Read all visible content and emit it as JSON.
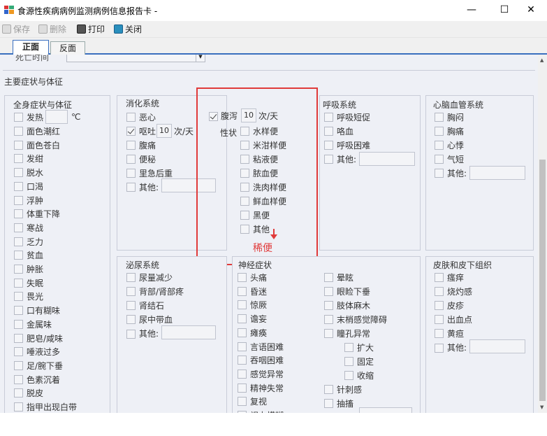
{
  "window": {
    "title": "食源性疾病病例监测病例信息报告卡 -",
    "minimize": "—",
    "maximize": "☐",
    "close": "✕"
  },
  "toolbar": {
    "save": "保存",
    "delete": "删除",
    "print": "打印",
    "close": "关闭"
  },
  "tabs": {
    "front": "正面",
    "back": "反面"
  },
  "partial_label": "死亡时间",
  "section_title": "主要症状与体征",
  "general": {
    "title": "全身症状与体征",
    "fever": "发热",
    "fever_unit": "℃",
    "items": [
      "面色潮红",
      "面色苍白",
      "发绀",
      "脱水",
      "口渴",
      "浮肿",
      "体重下降",
      "寒战",
      "乏力",
      "贫血",
      "肿胀",
      "失眠",
      "畏光",
      "口有糊味",
      "金属味",
      "肥皂/咸味",
      "唾液过多",
      "足/腕下垂",
      "色素沉着",
      "脱皮",
      "指甲出现白带"
    ]
  },
  "digestive": {
    "title": "消化系统",
    "nausea": "恶心",
    "vomit": "呕吐",
    "vomit_count": "10",
    "vomit_unit": "次/天",
    "items": [
      "腹痛",
      "便秘",
      "里急后重"
    ],
    "other": "其他:"
  },
  "diarrhea": {
    "label": "腹泻",
    "count": "10",
    "unit": "次/天",
    "shape_label": "性状",
    "items": [
      "水样便",
      "米泔样便",
      "粘液便",
      "脓血便",
      "洗肉样便",
      "鲜血样便",
      "黑便",
      "其他"
    ],
    "annotation": "稀便"
  },
  "respiratory": {
    "title": "呼吸系统",
    "items": [
      "呼吸短促",
      "咯血",
      "呼吸困难"
    ],
    "other": "其他:"
  },
  "cardio": {
    "title": "心脑血管系统",
    "items": [
      "胸闷",
      "胸痛",
      "心悸",
      "气短"
    ],
    "other": "其他:"
  },
  "urinary": {
    "title": "泌尿系统",
    "items": [
      "尿量减少",
      "背部/肾部疼",
      "肾结石",
      "尿中带血"
    ],
    "other": "其他:"
  },
  "neuro": {
    "title": "神经症状",
    "left": [
      "头痛",
      "昏迷",
      "惊厥",
      "谵妄",
      "瘫痪",
      "言语困难",
      "吞咽困难",
      "感觉异常",
      "精神失常",
      "复视",
      "视力模糊"
    ],
    "right": [
      "晕眩",
      "眼睑下垂",
      "肢体麻木",
      "末梢感觉障碍",
      "瞳孔异常"
    ],
    "pupil": [
      "扩大",
      "固定",
      "收缩"
    ],
    "right2": [
      "针刺感",
      "抽搐",
      "其他:"
    ]
  },
  "skin": {
    "title": "皮肤和皮下组织",
    "items": [
      "瘙痒",
      "烧灼感",
      "皮疹",
      "出血点",
      "黄疸"
    ],
    "other": "其他:"
  }
}
